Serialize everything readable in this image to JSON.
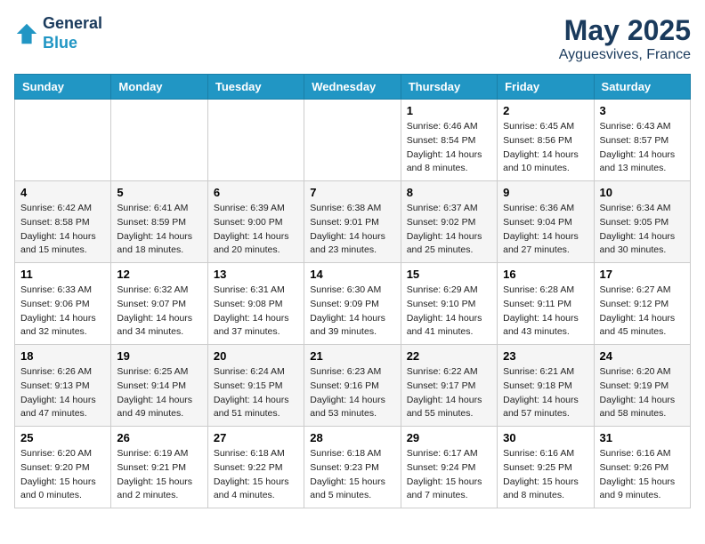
{
  "header": {
    "logo_line1": "General",
    "logo_line2": "Blue",
    "month": "May 2025",
    "location": "Ayguesvives, France"
  },
  "weekdays": [
    "Sunday",
    "Monday",
    "Tuesday",
    "Wednesday",
    "Thursday",
    "Friday",
    "Saturday"
  ],
  "weeks": [
    [
      {
        "day": "",
        "info": ""
      },
      {
        "day": "",
        "info": ""
      },
      {
        "day": "",
        "info": ""
      },
      {
        "day": "",
        "info": ""
      },
      {
        "day": "1",
        "info": "Sunrise: 6:46 AM\nSunset: 8:54 PM\nDaylight: 14 hours\nand 8 minutes."
      },
      {
        "day": "2",
        "info": "Sunrise: 6:45 AM\nSunset: 8:56 PM\nDaylight: 14 hours\nand 10 minutes."
      },
      {
        "day": "3",
        "info": "Sunrise: 6:43 AM\nSunset: 8:57 PM\nDaylight: 14 hours\nand 13 minutes."
      }
    ],
    [
      {
        "day": "4",
        "info": "Sunrise: 6:42 AM\nSunset: 8:58 PM\nDaylight: 14 hours\nand 15 minutes."
      },
      {
        "day": "5",
        "info": "Sunrise: 6:41 AM\nSunset: 8:59 PM\nDaylight: 14 hours\nand 18 minutes."
      },
      {
        "day": "6",
        "info": "Sunrise: 6:39 AM\nSunset: 9:00 PM\nDaylight: 14 hours\nand 20 minutes."
      },
      {
        "day": "7",
        "info": "Sunrise: 6:38 AM\nSunset: 9:01 PM\nDaylight: 14 hours\nand 23 minutes."
      },
      {
        "day": "8",
        "info": "Sunrise: 6:37 AM\nSunset: 9:02 PM\nDaylight: 14 hours\nand 25 minutes."
      },
      {
        "day": "9",
        "info": "Sunrise: 6:36 AM\nSunset: 9:04 PM\nDaylight: 14 hours\nand 27 minutes."
      },
      {
        "day": "10",
        "info": "Sunrise: 6:34 AM\nSunset: 9:05 PM\nDaylight: 14 hours\nand 30 minutes."
      }
    ],
    [
      {
        "day": "11",
        "info": "Sunrise: 6:33 AM\nSunset: 9:06 PM\nDaylight: 14 hours\nand 32 minutes."
      },
      {
        "day": "12",
        "info": "Sunrise: 6:32 AM\nSunset: 9:07 PM\nDaylight: 14 hours\nand 34 minutes."
      },
      {
        "day": "13",
        "info": "Sunrise: 6:31 AM\nSunset: 9:08 PM\nDaylight: 14 hours\nand 37 minutes."
      },
      {
        "day": "14",
        "info": "Sunrise: 6:30 AM\nSunset: 9:09 PM\nDaylight: 14 hours\nand 39 minutes."
      },
      {
        "day": "15",
        "info": "Sunrise: 6:29 AM\nSunset: 9:10 PM\nDaylight: 14 hours\nand 41 minutes."
      },
      {
        "day": "16",
        "info": "Sunrise: 6:28 AM\nSunset: 9:11 PM\nDaylight: 14 hours\nand 43 minutes."
      },
      {
        "day": "17",
        "info": "Sunrise: 6:27 AM\nSunset: 9:12 PM\nDaylight: 14 hours\nand 45 minutes."
      }
    ],
    [
      {
        "day": "18",
        "info": "Sunrise: 6:26 AM\nSunset: 9:13 PM\nDaylight: 14 hours\nand 47 minutes."
      },
      {
        "day": "19",
        "info": "Sunrise: 6:25 AM\nSunset: 9:14 PM\nDaylight: 14 hours\nand 49 minutes."
      },
      {
        "day": "20",
        "info": "Sunrise: 6:24 AM\nSunset: 9:15 PM\nDaylight: 14 hours\nand 51 minutes."
      },
      {
        "day": "21",
        "info": "Sunrise: 6:23 AM\nSunset: 9:16 PM\nDaylight: 14 hours\nand 53 minutes."
      },
      {
        "day": "22",
        "info": "Sunrise: 6:22 AM\nSunset: 9:17 PM\nDaylight: 14 hours\nand 55 minutes."
      },
      {
        "day": "23",
        "info": "Sunrise: 6:21 AM\nSunset: 9:18 PM\nDaylight: 14 hours\nand 57 minutes."
      },
      {
        "day": "24",
        "info": "Sunrise: 6:20 AM\nSunset: 9:19 PM\nDaylight: 14 hours\nand 58 minutes."
      }
    ],
    [
      {
        "day": "25",
        "info": "Sunrise: 6:20 AM\nSunset: 9:20 PM\nDaylight: 15 hours\nand 0 minutes."
      },
      {
        "day": "26",
        "info": "Sunrise: 6:19 AM\nSunset: 9:21 PM\nDaylight: 15 hours\nand 2 minutes."
      },
      {
        "day": "27",
        "info": "Sunrise: 6:18 AM\nSunset: 9:22 PM\nDaylight: 15 hours\nand 4 minutes."
      },
      {
        "day": "28",
        "info": "Sunrise: 6:18 AM\nSunset: 9:23 PM\nDaylight: 15 hours\nand 5 minutes."
      },
      {
        "day": "29",
        "info": "Sunrise: 6:17 AM\nSunset: 9:24 PM\nDaylight: 15 hours\nand 7 minutes."
      },
      {
        "day": "30",
        "info": "Sunrise: 6:16 AM\nSunset: 9:25 PM\nDaylight: 15 hours\nand 8 minutes."
      },
      {
        "day": "31",
        "info": "Sunrise: 6:16 AM\nSunset: 9:26 PM\nDaylight: 15 hours\nand 9 minutes."
      }
    ]
  ]
}
